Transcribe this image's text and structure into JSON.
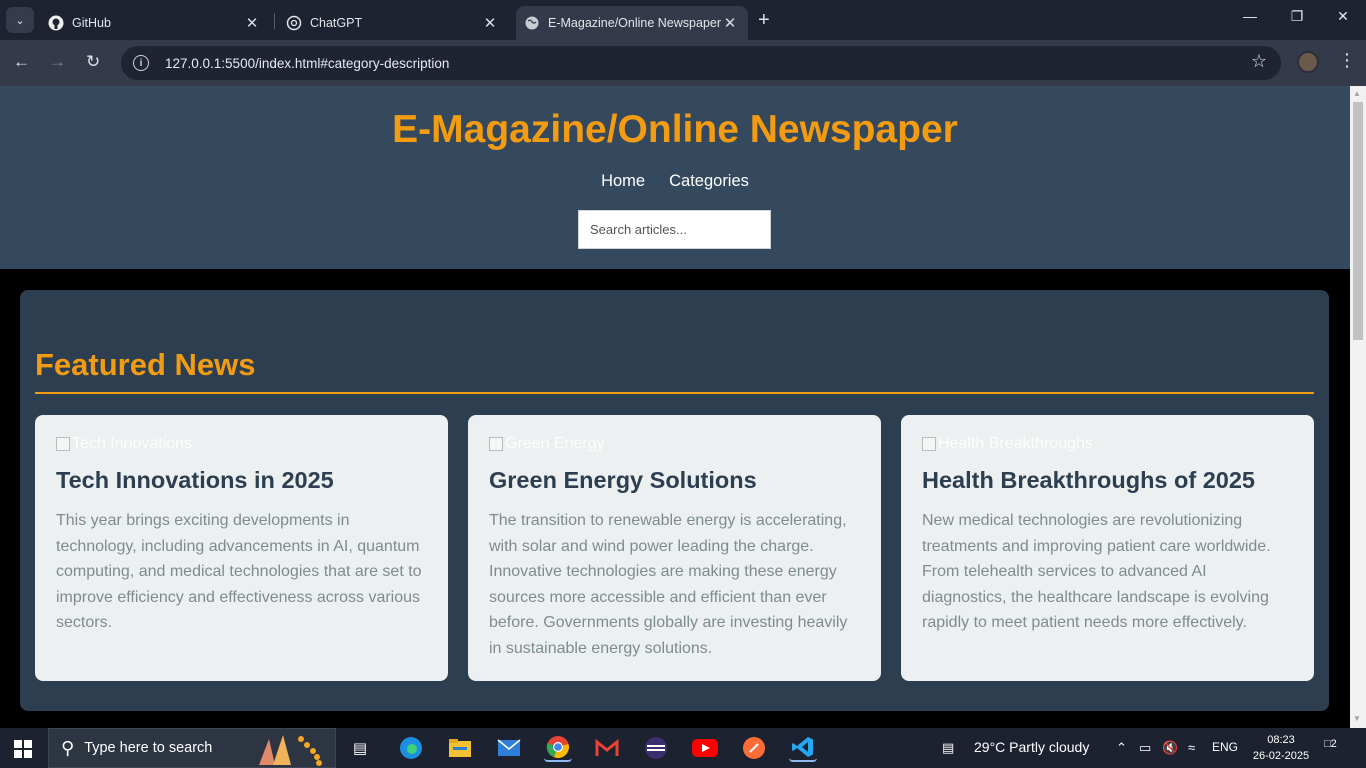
{
  "browser": {
    "tabs": [
      {
        "title": "GitHub",
        "icon": "github-icon"
      },
      {
        "title": "ChatGPT",
        "icon": "chatgpt-icon"
      },
      {
        "title": "E-Magazine/Online Newspaper",
        "icon": "globe-icon",
        "active": true
      }
    ],
    "url": "127.0.0.1:5500/index.html#category-description"
  },
  "site": {
    "title": "E-Magazine/Online Newspaper",
    "nav": [
      "Home",
      "Categories"
    ],
    "search_placeholder": "Search articles...",
    "featured_title": "Featured News",
    "accent_color": "#f39c12",
    "header_color": "#34495e",
    "cards": [
      {
        "img_alt": "Tech Innovations",
        "title": "Tech Innovations in 2025",
        "body": "This year brings exciting developments in technology, including advancements in AI, quantum computing, and medical technologies that are set to improve efficiency and effectiveness across various sectors."
      },
      {
        "img_alt": "Green Energy",
        "title": "Green Energy Solutions",
        "body": "The transition to renewable energy is accelerating, with solar and wind power leading the charge. Innovative technologies are making these energy sources more accessible and efficient than ever before. Governments globally are investing heavily in sustainable energy solutions."
      },
      {
        "img_alt": "Health Breakthroughs",
        "title": "Health Breakthroughs of 2025",
        "body": "New medical technologies are revolutionizing treatments and improving patient care worldwide. From telehealth services to advanced AI diagnostics, the healthcare landscape is evolving rapidly to meet patient needs more effectively."
      }
    ]
  },
  "taskbar": {
    "search_text": "Type here to search",
    "weather": "29°C  Partly cloudy",
    "language": "ENG",
    "time": "08:23",
    "date": "26-02-2025",
    "notifications": "2"
  }
}
